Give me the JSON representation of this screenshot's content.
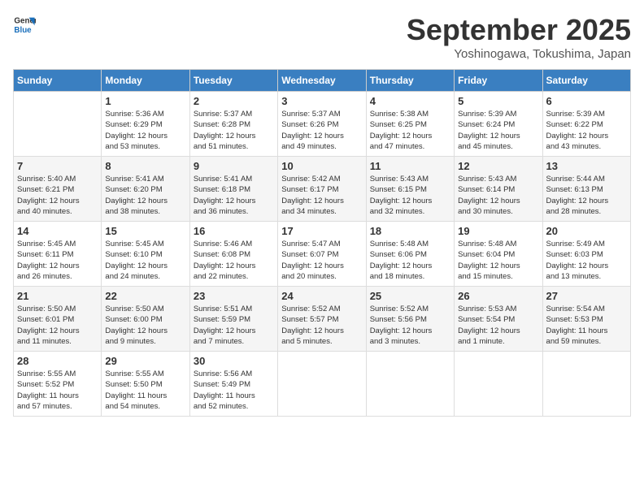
{
  "header": {
    "logo_general": "General",
    "logo_blue": "Blue",
    "month_title": "September 2025",
    "subtitle": "Yoshinogawa, Tokushima, Japan"
  },
  "calendar": {
    "days_of_week": [
      "Sunday",
      "Monday",
      "Tuesday",
      "Wednesday",
      "Thursday",
      "Friday",
      "Saturday"
    ],
    "weeks": [
      [
        {
          "day": "",
          "info": ""
        },
        {
          "day": "1",
          "info": "Sunrise: 5:36 AM\nSunset: 6:29 PM\nDaylight: 12 hours\nand 53 minutes."
        },
        {
          "day": "2",
          "info": "Sunrise: 5:37 AM\nSunset: 6:28 PM\nDaylight: 12 hours\nand 51 minutes."
        },
        {
          "day": "3",
          "info": "Sunrise: 5:37 AM\nSunset: 6:26 PM\nDaylight: 12 hours\nand 49 minutes."
        },
        {
          "day": "4",
          "info": "Sunrise: 5:38 AM\nSunset: 6:25 PM\nDaylight: 12 hours\nand 47 minutes."
        },
        {
          "day": "5",
          "info": "Sunrise: 5:39 AM\nSunset: 6:24 PM\nDaylight: 12 hours\nand 45 minutes."
        },
        {
          "day": "6",
          "info": "Sunrise: 5:39 AM\nSunset: 6:22 PM\nDaylight: 12 hours\nand 43 minutes."
        }
      ],
      [
        {
          "day": "7",
          "info": "Sunrise: 5:40 AM\nSunset: 6:21 PM\nDaylight: 12 hours\nand 40 minutes."
        },
        {
          "day": "8",
          "info": "Sunrise: 5:41 AM\nSunset: 6:20 PM\nDaylight: 12 hours\nand 38 minutes."
        },
        {
          "day": "9",
          "info": "Sunrise: 5:41 AM\nSunset: 6:18 PM\nDaylight: 12 hours\nand 36 minutes."
        },
        {
          "day": "10",
          "info": "Sunrise: 5:42 AM\nSunset: 6:17 PM\nDaylight: 12 hours\nand 34 minutes."
        },
        {
          "day": "11",
          "info": "Sunrise: 5:43 AM\nSunset: 6:15 PM\nDaylight: 12 hours\nand 32 minutes."
        },
        {
          "day": "12",
          "info": "Sunrise: 5:43 AM\nSunset: 6:14 PM\nDaylight: 12 hours\nand 30 minutes."
        },
        {
          "day": "13",
          "info": "Sunrise: 5:44 AM\nSunset: 6:13 PM\nDaylight: 12 hours\nand 28 minutes."
        }
      ],
      [
        {
          "day": "14",
          "info": "Sunrise: 5:45 AM\nSunset: 6:11 PM\nDaylight: 12 hours\nand 26 minutes."
        },
        {
          "day": "15",
          "info": "Sunrise: 5:45 AM\nSunset: 6:10 PM\nDaylight: 12 hours\nand 24 minutes."
        },
        {
          "day": "16",
          "info": "Sunrise: 5:46 AM\nSunset: 6:08 PM\nDaylight: 12 hours\nand 22 minutes."
        },
        {
          "day": "17",
          "info": "Sunrise: 5:47 AM\nSunset: 6:07 PM\nDaylight: 12 hours\nand 20 minutes."
        },
        {
          "day": "18",
          "info": "Sunrise: 5:48 AM\nSunset: 6:06 PM\nDaylight: 12 hours\nand 18 minutes."
        },
        {
          "day": "19",
          "info": "Sunrise: 5:48 AM\nSunset: 6:04 PM\nDaylight: 12 hours\nand 15 minutes."
        },
        {
          "day": "20",
          "info": "Sunrise: 5:49 AM\nSunset: 6:03 PM\nDaylight: 12 hours\nand 13 minutes."
        }
      ],
      [
        {
          "day": "21",
          "info": "Sunrise: 5:50 AM\nSunset: 6:01 PM\nDaylight: 12 hours\nand 11 minutes."
        },
        {
          "day": "22",
          "info": "Sunrise: 5:50 AM\nSunset: 6:00 PM\nDaylight: 12 hours\nand 9 minutes."
        },
        {
          "day": "23",
          "info": "Sunrise: 5:51 AM\nSunset: 5:59 PM\nDaylight: 12 hours\nand 7 minutes."
        },
        {
          "day": "24",
          "info": "Sunrise: 5:52 AM\nSunset: 5:57 PM\nDaylight: 12 hours\nand 5 minutes."
        },
        {
          "day": "25",
          "info": "Sunrise: 5:52 AM\nSunset: 5:56 PM\nDaylight: 12 hours\nand 3 minutes."
        },
        {
          "day": "26",
          "info": "Sunrise: 5:53 AM\nSunset: 5:54 PM\nDaylight: 12 hours\nand 1 minute."
        },
        {
          "day": "27",
          "info": "Sunrise: 5:54 AM\nSunset: 5:53 PM\nDaylight: 11 hours\nand 59 minutes."
        }
      ],
      [
        {
          "day": "28",
          "info": "Sunrise: 5:55 AM\nSunset: 5:52 PM\nDaylight: 11 hours\nand 57 minutes."
        },
        {
          "day": "29",
          "info": "Sunrise: 5:55 AM\nSunset: 5:50 PM\nDaylight: 11 hours\nand 54 minutes."
        },
        {
          "day": "30",
          "info": "Sunrise: 5:56 AM\nSunset: 5:49 PM\nDaylight: 11 hours\nand 52 minutes."
        },
        {
          "day": "",
          "info": ""
        },
        {
          "day": "",
          "info": ""
        },
        {
          "day": "",
          "info": ""
        },
        {
          "day": "",
          "info": ""
        }
      ]
    ]
  }
}
